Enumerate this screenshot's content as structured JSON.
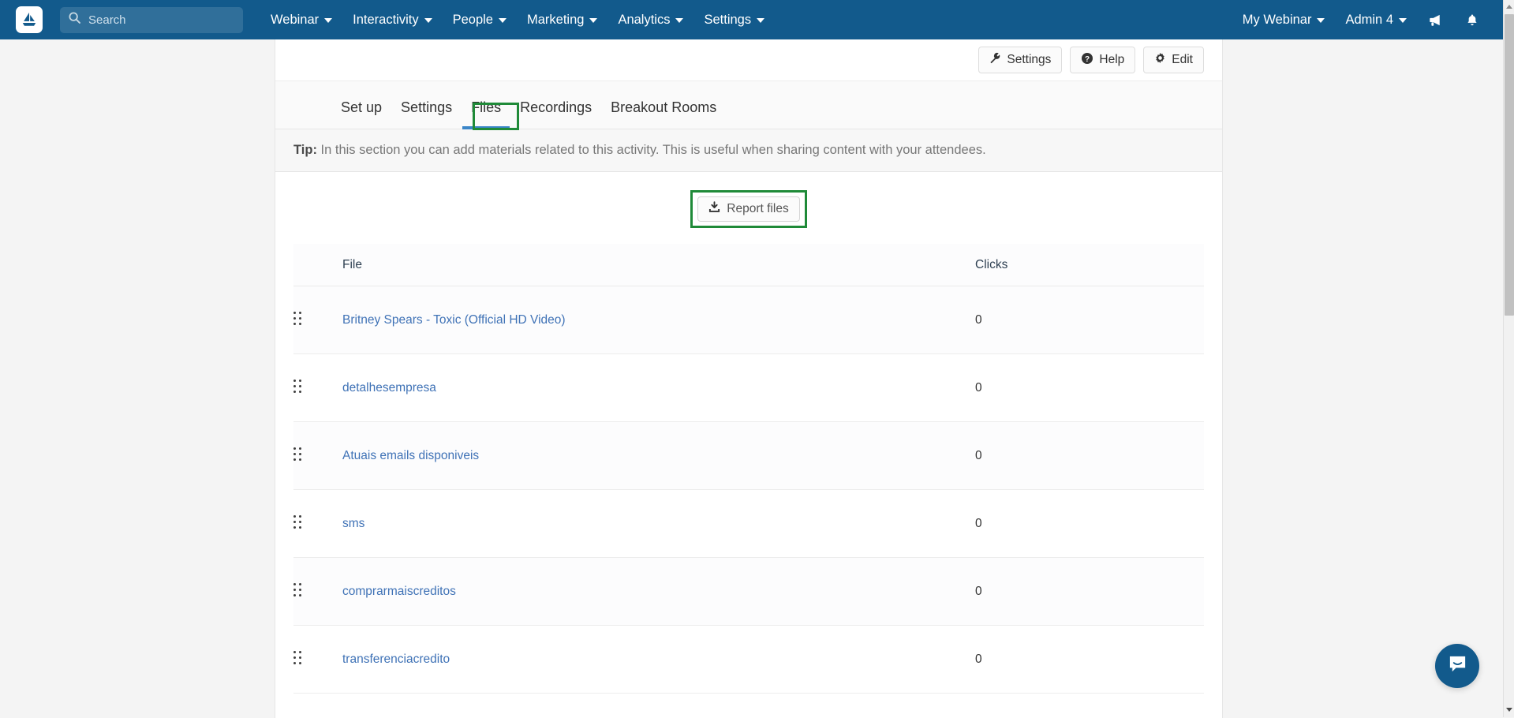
{
  "navbar": {
    "logo_icon": "sailboat-logo-icon",
    "search": {
      "placeholder": "Search",
      "value": "",
      "icon": "search-icon"
    },
    "items": [
      {
        "label": "Webinar",
        "caret": "chevron-down-icon"
      },
      {
        "label": "Interactivity",
        "caret": "chevron-down-icon"
      },
      {
        "label": "People",
        "caret": "chevron-down-icon"
      },
      {
        "label": "Marketing",
        "caret": "chevron-down-icon"
      },
      {
        "label": "Analytics",
        "caret": "chevron-down-icon"
      },
      {
        "label": "Settings",
        "caret": "chevron-down-icon"
      }
    ],
    "right": {
      "webinar_selector": "My Webinar",
      "account": "Admin 4",
      "announcements_icon": "megaphone-icon",
      "notifications_icon": "bell-icon"
    },
    "background_color": "#125A8C"
  },
  "action_bar": {
    "buttons": [
      {
        "label": "Settings",
        "icon": "wrench-icon"
      },
      {
        "label": "Help",
        "icon": "question-circle-icon"
      },
      {
        "label": "Edit",
        "icon": "gear-icon"
      }
    ]
  },
  "tabs": {
    "items": [
      {
        "label": "Set up",
        "active": false
      },
      {
        "label": "Settings",
        "active": false
      },
      {
        "label": "Files",
        "active": true
      },
      {
        "label": "Recordings",
        "active": false
      },
      {
        "label": "Breakout Rooms",
        "active": false
      }
    ],
    "active_underline_color": "#3b86c8",
    "highlight_color": "#1f8a38"
  },
  "tip": {
    "label": "Tip:",
    "text": " In this section you can add materials related to this activity. This is useful when sharing content with your attendees."
  },
  "report": {
    "button_label": "Report files",
    "icon": "download-icon",
    "highlight_color": "#1f8a38"
  },
  "table": {
    "columns": [
      "",
      "File",
      "Clicks"
    ],
    "rows": [
      {
        "grip": "drag-handle-icon",
        "file": "Britney Spears - Toxic (Official HD Video)",
        "clicks": "0"
      },
      {
        "grip": "drag-handle-icon",
        "file": "detalhesempresa",
        "clicks": "0"
      },
      {
        "grip": "drag-handle-icon",
        "file": "Atuais emails disponiveis",
        "clicks": "0"
      },
      {
        "grip": "drag-handle-icon",
        "file": "sms",
        "clicks": "0"
      },
      {
        "grip": "drag-handle-icon",
        "file": "comprarmaiscreditos",
        "clicks": "0"
      },
      {
        "grip": "drag-handle-icon",
        "file": "transferenciacredito",
        "clicks": "0"
      }
    ],
    "link_color": "#3f72b6"
  },
  "intercom": {
    "icon": "chat-bubble-icon",
    "color": "#125A8C"
  },
  "scrollbar": {
    "up_icon": "scroll-up-arrow-icon",
    "down_icon": "scroll-down-arrow-icon"
  }
}
